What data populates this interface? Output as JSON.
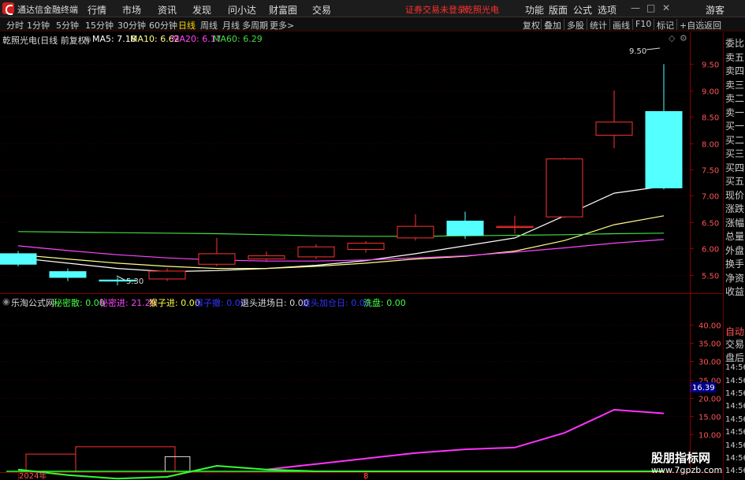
{
  "app": {
    "title": "通达信金融终端"
  },
  "menu": [
    "行情",
    "市场",
    "资讯",
    "发现",
    "问小达",
    "财富圈",
    "交易"
  ],
  "status": {
    "login": "证券交易未登录",
    "stock_name": "乾照光电"
  },
  "menu_right": [
    "功能",
    "版面",
    "公式",
    "选项",
    "游客"
  ],
  "timeframes": [
    "分时",
    "1分钟",
    "5分钟",
    "15分钟",
    "30分钟",
    "60分钟",
    "日线",
    "周线",
    "月线",
    "多周期",
    "更多>"
  ],
  "active_timeframe": "日线",
  "toolbar_right": [
    "复权",
    "叠加",
    "多股",
    "统计",
    "画线",
    "F10",
    "标记",
    "+自选",
    "返回"
  ],
  "main_chart": {
    "title": "乾照光电(日线 前复权)",
    "ma": [
      {
        "label": "MA5: 7.18",
        "color": "#ffffff"
      },
      {
        "label": "MA10: 6.62",
        "color": "#ffff88"
      },
      {
        "label": "MA20: 6.17",
        "color": "#ff44ff"
      },
      {
        "label": "MA60: 6.29",
        "color": "#44dd44"
      }
    ],
    "high_label": "9.50",
    "low_label": "5.30"
  },
  "sub_chart": {
    "title": "乐淘公式网",
    "fields": [
      {
        "label": "秘密散: 0.00",
        "color": "#44ff44"
      },
      {
        "label": "秘密进: 21.29",
        "color": "#ff44ff"
      },
      {
        "label": "猴子进: 0.00",
        "color": "#ffff44"
      },
      {
        "label": "猴子撤: 0.00",
        "color": "#3333ff"
      },
      {
        "label": "退头进场日: 0.00",
        "color": "#dddddd"
      },
      {
        "label": "退头加仓日: 0.00",
        "color": "#3333ff"
      },
      {
        "label": "洗盘: 0.00",
        "color": "#44ff44"
      }
    ],
    "current_value": "16.39"
  },
  "x_labels": {
    "year": "2024年",
    "month": "8"
  },
  "side_panel": [
    "委比",
    "卖五",
    "卖四",
    "卖三",
    "卖二",
    "卖一",
    "买一",
    "买二",
    "买三",
    "买四",
    "买五",
    "现价",
    "涨跌",
    "涨幅",
    "总量",
    "外盘",
    "换手",
    "净资",
    "收益",
    "自动",
    "交易",
    "盘后",
    "14:56",
    "14:56",
    "14:56",
    "14:56",
    "14:56",
    "14:56",
    "14:56",
    "14:56",
    "14:56"
  ],
  "watermark": {
    "line1": "股朋指标网",
    "line2": "www.7gpzb.com"
  },
  "colors": {
    "up": "#ff3232",
    "down": "#54ffff",
    "ma5": "#ffffff",
    "ma10": "#ffff88",
    "ma20": "#ff44ff",
    "ma60": "#44dd44",
    "signal_magenta": "#ff33ff",
    "signal_green": "#33ff33"
  },
  "chart_data": [
    {
      "type": "candlestick",
      "title": "乾照光电(日线 前复权)",
      "y_ticks": [
        5.5,
        6.0,
        6.5,
        7.0,
        7.5,
        8.0,
        8.5,
        9.0,
        9.5
      ],
      "ylim": [
        5.15,
        9.85
      ],
      "candles": [
        {
          "open": 5.9,
          "close": 5.7,
          "high": 5.95,
          "low": 5.66
        },
        {
          "open": 5.56,
          "close": 5.45,
          "high": 5.62,
          "low": 5.38
        },
        {
          "open": 5.4,
          "close": 5.38,
          "high": 5.45,
          "low": 5.3
        },
        {
          "open": 5.42,
          "close": 5.57,
          "high": 5.62,
          "low": 5.38
        },
        {
          "open": 5.7,
          "close": 5.9,
          "high": 6.2,
          "low": 5.66
        },
        {
          "open": 5.8,
          "close": 5.86,
          "high": 5.94,
          "low": 5.74
        },
        {
          "open": 5.84,
          "close": 6.03,
          "high": 6.08,
          "low": 5.8
        },
        {
          "open": 5.98,
          "close": 6.1,
          "high": 6.14,
          "low": 5.92
        },
        {
          "open": 6.2,
          "close": 6.42,
          "high": 6.65,
          "low": 6.15
        },
        {
          "open": 6.52,
          "close": 6.25,
          "high": 6.7,
          "low": 6.18
        },
        {
          "open": 6.4,
          "close": 6.42,
          "high": 6.62,
          "low": 6.28
        },
        {
          "open": 6.6,
          "close": 7.7,
          "high": 7.72,
          "low": 6.58
        },
        {
          "open": 8.15,
          "close": 8.4,
          "high": 9.0,
          "low": 7.9
        },
        {
          "open": 8.6,
          "close": 7.15,
          "high": 9.5,
          "low": 7.12
        }
      ],
      "series": [
        {
          "name": "MA5",
          "values": [
            5.82,
            5.72,
            5.62,
            5.56,
            5.58,
            5.62,
            5.68,
            5.77,
            5.9,
            6.05,
            6.2,
            6.62,
            7.05,
            7.18
          ]
        },
        {
          "name": "MA10",
          "values": [
            5.88,
            5.8,
            5.72,
            5.66,
            5.62,
            5.62,
            5.66,
            5.72,
            5.8,
            5.85,
            5.95,
            6.15,
            6.45,
            6.62
          ]
        },
        {
          "name": "MA20",
          "values": [
            6.05,
            5.96,
            5.88,
            5.82,
            5.78,
            5.76,
            5.76,
            5.78,
            5.82,
            5.86,
            5.93,
            6.01,
            6.1,
            6.17
          ]
        },
        {
          "name": "MA60",
          "values": [
            6.32,
            6.31,
            6.3,
            6.29,
            6.28,
            6.26,
            6.24,
            6.23,
            6.23,
            6.24,
            6.25,
            6.26,
            6.28,
            6.29
          ]
        }
      ]
    },
    {
      "type": "line",
      "title": "乐淘公式网",
      "y_ticks": [
        10.0,
        15.0,
        20.0,
        25.0,
        30.0,
        35.0,
        40.0
      ],
      "ylim": [
        0.0,
        43.0
      ],
      "series": [
        {
          "name": "秘密进",
          "values": [
            null,
            null,
            null,
            null,
            null,
            0.5,
            2.0,
            3.5,
            5.0,
            6.0,
            6.5,
            10.5,
            16.8,
            15.8
          ]
        },
        {
          "name": "秘密散",
          "values": [
            0.5,
            -1.0,
            -2.0,
            -1.5,
            1.5,
            0.5,
            0.0,
            0.0,
            0.0,
            0.0,
            0.0,
            0.0,
            0.0,
            0.0
          ]
        }
      ],
      "boxes": [
        {
          "x_from": 0.5,
          "x_to": 1.5,
          "bottom": 0.0,
          "top": 4.7,
          "color": "#ff3232"
        },
        {
          "x_from": 1.5,
          "x_to": 3.5,
          "bottom": 0.0,
          "top": 6.7,
          "color": "#ff3232"
        },
        {
          "x_from": 3.3,
          "x_to": 3.8,
          "bottom": 0.0,
          "top": 4.0,
          "color": "#dddddd"
        }
      ]
    }
  ]
}
